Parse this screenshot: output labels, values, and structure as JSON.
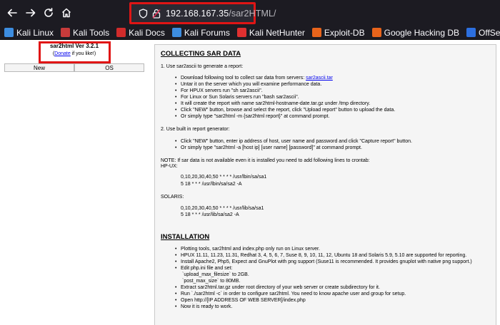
{
  "browser": {
    "url_host": "192.168.167.35",
    "url_path": "/sar2HTML/"
  },
  "bookmarks": [
    {
      "label": "Kali Linux",
      "color": "#3d8de0"
    },
    {
      "label": "Kali Tools",
      "color": "#c73b3b"
    },
    {
      "label": "Kali Docs",
      "color": "#d12b2b"
    },
    {
      "label": "Kali Forums",
      "color": "#3d8de0"
    },
    {
      "label": "Kali NetHunter",
      "color": "#e03030"
    },
    {
      "label": "Exploit-DB",
      "color": "#e8641b"
    },
    {
      "label": "Google Hacking DB",
      "color": "#e8641b"
    },
    {
      "label": "OffSec",
      "color": "#2c6fdf"
    }
  ],
  "left": {
    "version": "sar2html Ver 3.2.1",
    "donate_open": "(",
    "donate_link": "Donate",
    "donate_close": " if you like!)",
    "buttons": [
      "New",
      "OS"
    ]
  },
  "collecting": {
    "heading": "COLLECTING SAR DATA",
    "step1": "1. Use sar2ascii to generate a report:",
    "step1_items": [
      "Download following tool to collect sar data from servers: ",
      "Untar it on the server which you will examine performance data.",
      "For HPUX servers run \"sh sar2ascii\".",
      "For Linux or Sun Solaris servers run \"bash sar2ascii\".",
      "It will create the report with name sar2html-hostname-date.tar.gz under /tmp directory.",
      "Click \"NEW\" button, browse and select the report, click \"Upload report\" button to upload the data.",
      "Or simply type \"sar2html -m {sar2html report}\" at command prompt."
    ],
    "tool_link": "sar2ascii.tar",
    "step2": "2. Use built in report generator:",
    "step2_items": [
      "Click \"NEW\" button, enter ip address of host, user name and password and click \"Capture report\" button.",
      "Or simply type \"sar2html -a [host ip] [user name] [password]\" at command prompt."
    ],
    "note": "NOTE: If sar data is not available even it is installed you need to add following lines to crontab:",
    "hpux_label": "HP-UX:",
    "hpux_lines": [
      "0,10,20,30,40,50 * * * * /usr/lbin/sa/sa1",
      "5 18 * * * /usr/lbin/sa/sa2 -A"
    ],
    "solaris_label": "SOLARIS:",
    "solaris_lines": [
      "0,10,20,30,40,50 * * * * /usr/lib/sa/sa1",
      "5 18 * * * /usr/lib/sa/sa2 -A"
    ]
  },
  "installation": {
    "heading": "INSTALLATION",
    "items": [
      "Plotting tools, sar2html and index.php only run on Linux server.",
      "HPUX 11.11, 11.23, 11.31, Redhat 3, 4, 5, 6, 7, Suse 8, 9, 10, 11, 12, Ubuntu 18 and Solaris 5.9, 5.10 are supported for reporting.",
      "Install Apache2, Php5, Expect and GnuPlot with png support (Suse11 is recommended. It provides gnuplot with native png support.)",
      "Edit php.ini file and set:"
    ],
    "php_settings": [
      "`upload_max_filesize` to 2GB.",
      "`post_max_size` to 80MB."
    ],
    "items2": [
      "Extract sar2html.tar.gz under root directory of your web server or create subdirectory for it.",
      "Run `./sar2html -c` in order to configure sar2html. You need to know apache user and group for setup.",
      "Open http://[IP ADDRESS OF WEB SERVER]/index.php",
      "Now it is ready to work."
    ]
  }
}
